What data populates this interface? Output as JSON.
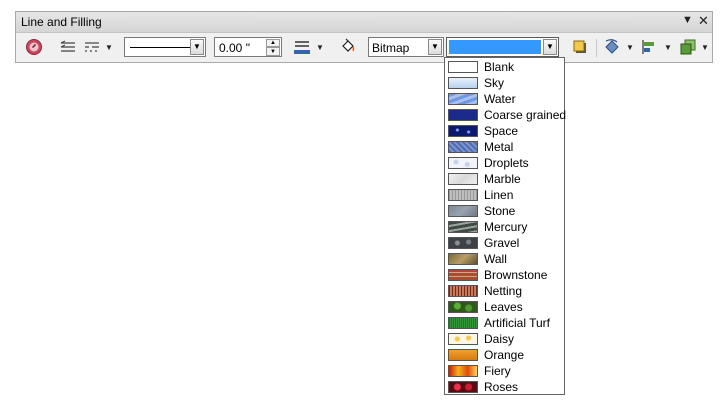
{
  "toolbar": {
    "title": "Line and Filling",
    "line_width": "0.00 \"",
    "area_style": "Bitmap"
  },
  "bitmap_popup": {
    "items": [
      {
        "label": "Blank"
      },
      {
        "label": "Sky"
      },
      {
        "label": "Water"
      },
      {
        "label": "Coarse grained"
      },
      {
        "label": "Space"
      },
      {
        "label": "Metal"
      },
      {
        "label": "Droplets"
      },
      {
        "label": "Marble"
      },
      {
        "label": "Linen"
      },
      {
        "label": "Stone"
      },
      {
        "label": "Mercury"
      },
      {
        "label": "Gravel"
      },
      {
        "label": "Wall"
      },
      {
        "label": "Brownstone"
      },
      {
        "label": "Netting"
      },
      {
        "label": "Leaves"
      },
      {
        "label": "Artificial Turf"
      },
      {
        "label": "Daisy"
      },
      {
        "label": "Orange"
      },
      {
        "label": "Fiery"
      },
      {
        "label": "Roses"
      }
    ]
  }
}
